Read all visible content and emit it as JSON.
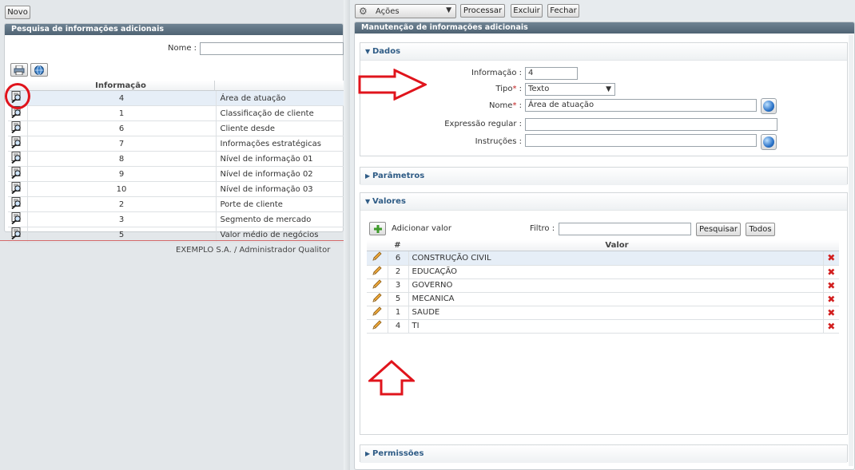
{
  "left": {
    "novo_label": "Novo",
    "panel_title": "Pesquisa de informações adicionais",
    "nome_label": "Nome :",
    "column_header": "Informação",
    "rows": [
      {
        "num": "4",
        "desc": "Área de atuação"
      },
      {
        "num": "1",
        "desc": "Classificação de cliente"
      },
      {
        "num": "6",
        "desc": "Cliente desde"
      },
      {
        "num": "7",
        "desc": "Informações estratégicas"
      },
      {
        "num": "8",
        "desc": "Nível de informação 01"
      },
      {
        "num": "9",
        "desc": "Nível de informação 02"
      },
      {
        "num": "10",
        "desc": "Nível de informação 03"
      },
      {
        "num": "2",
        "desc": "Porte de cliente"
      },
      {
        "num": "3",
        "desc": "Segmento de mercado"
      },
      {
        "num": "5",
        "desc": "Valor médio de negócios"
      }
    ],
    "footer": "EXEMPLO S.A. / Administrador Qualitor"
  },
  "toolbar": {
    "acoes_label": "Ações",
    "processar_label": "Processar",
    "excluir_label": "Excluir",
    "fechar_label": "Fechar"
  },
  "right": {
    "panel_title": "Manutenção de informações adicionais",
    "dados_title": "Dados",
    "informacao_label": "Informação :",
    "informacao_value": "4",
    "tipo_label": "Tipo",
    "tipo_value": "Texto",
    "nome_label": "Nome",
    "nome_value": "Área de atuação",
    "expressao_label": "Expressão regular :",
    "expressao_value": "",
    "instrucoes_label": "Instruções :",
    "instrucoes_value": "",
    "required_mark": "*",
    "colon": ":",
    "parametros_title": "Parâmetros",
    "valores_title": "Valores",
    "adicionar_label": "Adicionar valor",
    "filtro_label": "Filtro :",
    "filtro_value": "",
    "pesquisar_label": "Pesquisar",
    "todos_label": "Todos",
    "valores_col_num": "#",
    "valores_col_valor": "Valor",
    "valores_rows": [
      {
        "num": "6",
        "valor": "CONSTRUÇÃO CIVIL"
      },
      {
        "num": "2",
        "valor": "EDUCAÇÃO"
      },
      {
        "num": "3",
        "valor": "GOVERNO"
      },
      {
        "num": "5",
        "valor": "MECANICA"
      },
      {
        "num": "1",
        "valor": "SAUDE"
      },
      {
        "num": "4",
        "valor": "TI"
      }
    ],
    "permissoes_title": "Permissões"
  },
  "colors": {
    "annotation_red": "#e0141c",
    "header_bg": "#5a6e7e",
    "section_title": "#2f5c86",
    "selected_row": "#e6eef7"
  }
}
